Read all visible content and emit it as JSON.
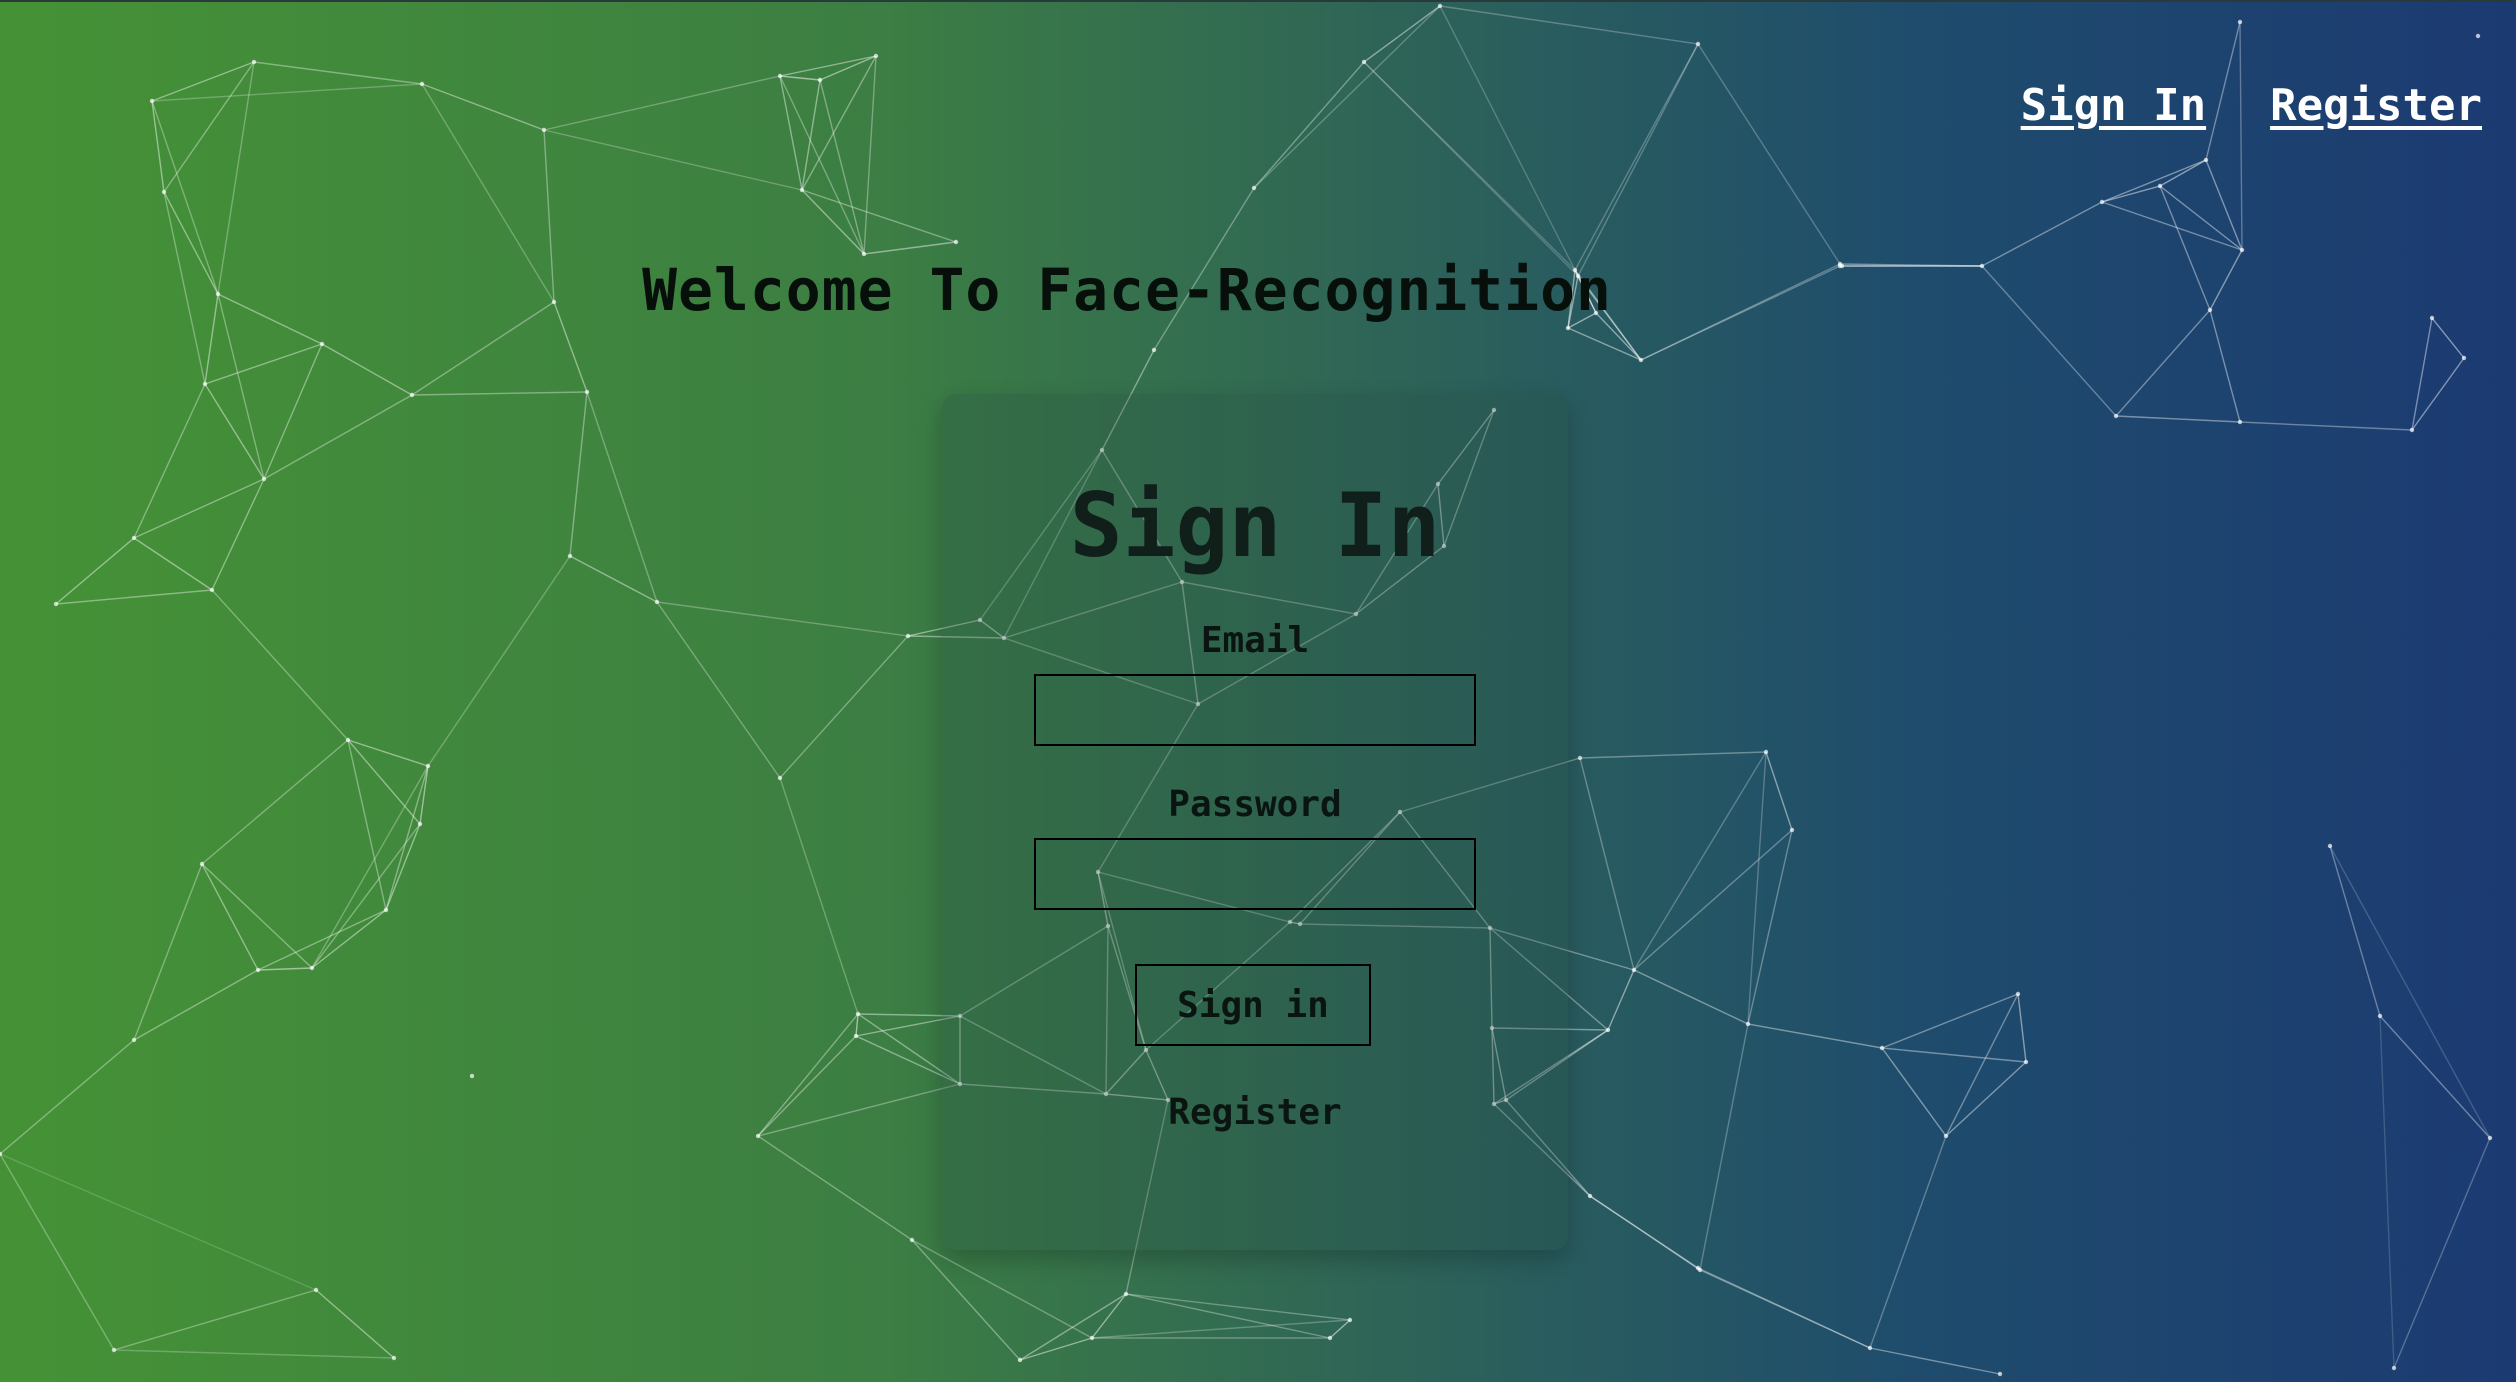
{
  "nav": {
    "signin_label": "Sign In",
    "register_label": "Register"
  },
  "welcome": "Welcome To Face-Recognition",
  "form": {
    "title": "Sign In",
    "email_label": "Email",
    "email_value": "",
    "password_label": "Password",
    "password_value": "",
    "submit_label": "Sign in",
    "register_label": "Register"
  },
  "colors": {
    "gradient_left": "#459236",
    "gradient_right": "#1b3a72",
    "particle_line": "#ffffff"
  }
}
